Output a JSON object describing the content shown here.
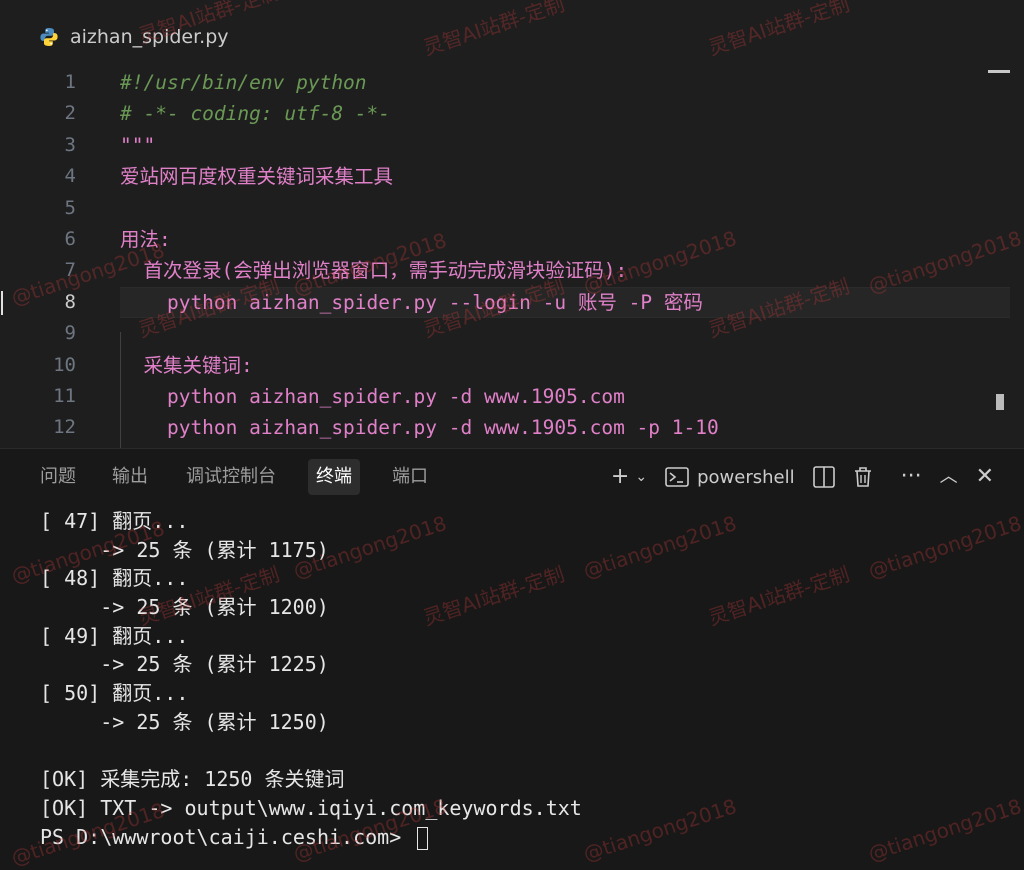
{
  "editor": {
    "tab_label": "aizhan_spider.py",
    "lines": [
      {
        "n": "1",
        "text": "#!/usr/bin/env python",
        "kind": "comment"
      },
      {
        "n": "2",
        "text": "# -*- coding: utf-8 -*-",
        "kind": "comment"
      },
      {
        "n": "3",
        "text": "\"\"\"",
        "kind": "doc"
      },
      {
        "n": "4",
        "text": "爱站网百度权重关键词采集工具",
        "kind": "doc"
      },
      {
        "n": "5",
        "text": "",
        "kind": "doc"
      },
      {
        "n": "6",
        "text": "用法:",
        "kind": "doc"
      },
      {
        "n": "7",
        "text": "  首次登录(会弹出浏览器窗口，需手动完成滑块验证码):",
        "kind": "doc"
      },
      {
        "n": "8",
        "text": "    python aizhan_spider.py --login -u 账号 -P 密码",
        "kind": "doc"
      },
      {
        "n": "9",
        "text": "",
        "kind": "doc"
      },
      {
        "n": "10",
        "text": "  采集关键词:",
        "kind": "doc"
      },
      {
        "n": "11",
        "text": "    python aizhan_spider.py -d www.1905.com",
        "kind": "doc"
      },
      {
        "n": "12",
        "text": "    python aizhan_spider.py -d www.1905.com -p 1-10",
        "kind": "doc"
      }
    ],
    "current_line": "8"
  },
  "panel": {
    "tabs": [
      "问题",
      "输出",
      "调试控制台",
      "终端",
      "端口"
    ],
    "active_tab": "终端",
    "shell_label": "powershell",
    "icons": [
      "add-terminal-icon",
      "chevron-down-icon",
      "terminal-icon",
      "split-icon",
      "trash-icon",
      "more-icon",
      "maximize-icon",
      "close-icon"
    ]
  },
  "terminal": {
    "lines": [
      "[ 47] 翻页...",
      "     -> 25 条 (累计 1175)",
      "[ 48] 翻页...",
      "     -> 25 条 (累计 1200)",
      "[ 49] 翻页...",
      "     -> 25 条 (累计 1225)",
      "[ 50] 翻页...",
      "     -> 25 条 (累计 1250)",
      "",
      "[OK] 采集完成: 1250 条关键词",
      "[OK] TXT -> output\\www.iqiyi.com_keywords.txt"
    ],
    "prompt": "PS D:\\wwwroot\\caiji.ceshi.com> "
  },
  "watermark": {
    "text_a": "灵智AI站群-定制",
    "text_b": "@tiangong2018"
  },
  "colors": {
    "background": "#1e1e1e",
    "panel": "#181818",
    "docstring": "#e080c8",
    "comment": "#6a9955",
    "watermark": "#c83c3c"
  }
}
